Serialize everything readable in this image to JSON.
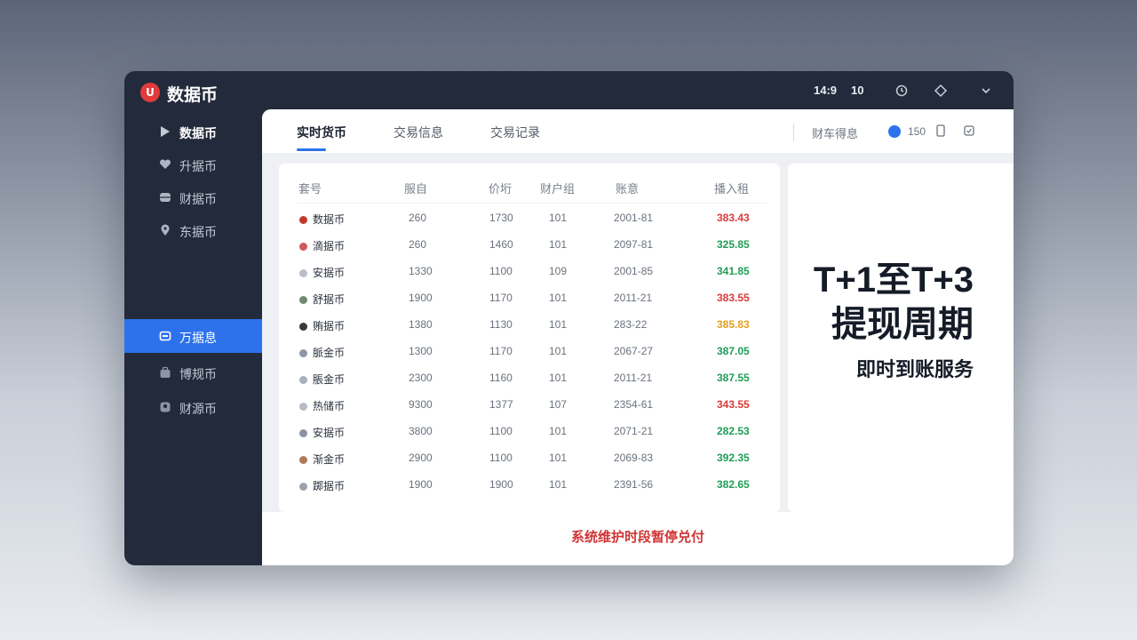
{
  "app": {
    "title": "数据币",
    "logo_text": "U"
  },
  "titlebar": {
    "time": "14:9",
    "num": "10",
    "icons": [
      "refresh-icon",
      "diamond-icon",
      "chevron-down-icon"
    ]
  },
  "sidebar": {
    "items": [
      {
        "label": "数据币",
        "icon": "play-icon"
      },
      {
        "label": "升据币",
        "icon": "heart-icon"
      },
      {
        "label": "财据币",
        "icon": "database-icon"
      },
      {
        "label": "东据币",
        "icon": "location-pin-icon"
      },
      {
        "label": "万据息",
        "icon": "wallet-icon",
        "active": true
      },
      {
        "label": "博规币",
        "icon": "bag-icon"
      },
      {
        "label": "财源币",
        "icon": "face-icon"
      }
    ]
  },
  "tabs": [
    {
      "label": "实时货币",
      "active": true
    },
    {
      "label": "交易信息"
    },
    {
      "label": "交易记录"
    }
  ],
  "toolbar_right": {
    "label": "财车得息",
    "count": "150",
    "icons": [
      "phone-icon",
      "document-icon"
    ]
  },
  "table": {
    "headers": [
      "套号",
      "服自",
      "价垳",
      "财户组",
      "账意",
      "播入租"
    ],
    "rows": [
      {
        "name": "数据币",
        "c1": "260",
        "c2": "1730",
        "c3": "101",
        "c4": "2001-81",
        "value": "383.43",
        "color": "#d93a3a",
        "icon_color": "#c0392b"
      },
      {
        "name": "滴据币",
        "c1": "260",
        "c2": "1460",
        "c3": "101",
        "c4": "2097-81",
        "value": "325.85",
        "color": "#1f9d55",
        "icon_color": "#d05a5a"
      },
      {
        "name": "安据币",
        "c1": "1330",
        "c2": "1100",
        "c3": "109",
        "c4": "2001-85",
        "value": "341.85",
        "color": "#1f9d55",
        "icon_color": "#b9bfc8"
      },
      {
        "name": "舒据币",
        "c1": "1900",
        "c2": "1170",
        "c3": "101",
        "c4": "2011-21",
        "value": "383.55",
        "color": "#d93a3a",
        "icon_color": "#6f8a6f"
      },
      {
        "name": "贿据币",
        "c1": "1380",
        "c2": "1130",
        "c3": "101",
        "c4": "283-22",
        "value": "385.83",
        "color": "#e0a020",
        "icon_color": "#3a3a3a"
      },
      {
        "name": "脈金币",
        "c1": "1300",
        "c2": "1170",
        "c3": "101",
        "c4": "2067-27",
        "value": "387.05",
        "color": "#1f9d55",
        "icon_color": "#8e97a8"
      },
      {
        "name": "脹金币",
        "c1": "2300",
        "c2": "1160",
        "c3": "101",
        "c4": "2011-21",
        "value": "387.55",
        "color": "#1f9d55",
        "icon_color": "#a8b0bc"
      },
      {
        "name": "热储币",
        "c1": "9300",
        "c2": "1377",
        "c3": "107",
        "c4": "2354-61",
        "value": "343.55",
        "color": "#d93a3a",
        "icon_color": "#b5bcc6"
      },
      {
        "name": "安据币",
        "c1": "3800",
        "c2": "1100",
        "c3": "101",
        "c4": "2071-21",
        "value": "282.53",
        "color": "#1f9d55",
        "icon_color": "#8a93a3"
      },
      {
        "name": "渐金币",
        "c1": "2900",
        "c2": "1100",
        "c3": "101",
        "c4": "2069-83",
        "value": "392.35",
        "color": "#1f9d55",
        "icon_color": "#b07a5a"
      },
      {
        "name": "踯据币",
        "c1": "1900",
        "c2": "1900",
        "c3": "101",
        "c4": "2391-56",
        "value": "382.65",
        "color": "#1f9d55",
        "icon_color": "#9aa2ae"
      }
    ]
  },
  "promo": {
    "line1": "T+1至T+3",
    "line2": "提现周期",
    "line3": "即时到账服务"
  },
  "footer": {
    "notice": "系统维护时段暂停兑付"
  }
}
